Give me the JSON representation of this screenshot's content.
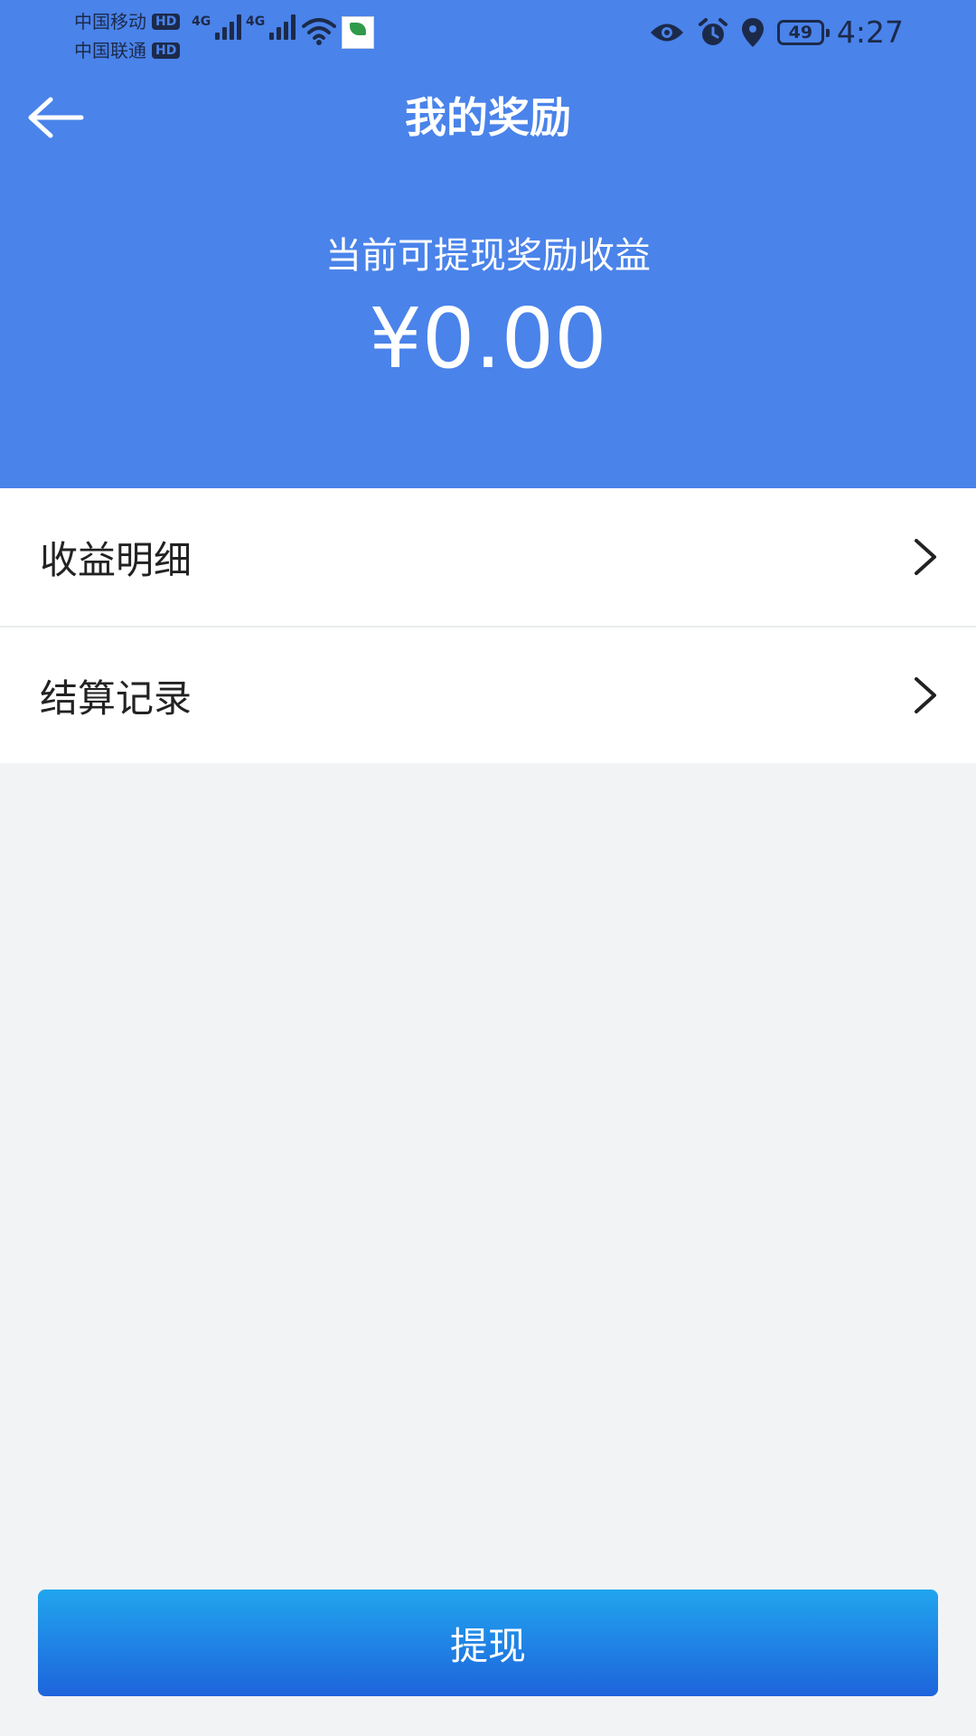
{
  "status_bar": {
    "carrier1": "中国移动",
    "carrier2": "中国联通",
    "hd": "HD",
    "net1": "4G",
    "net2": "4G",
    "battery": "49",
    "time": "4:27"
  },
  "header": {
    "title": "我的奖励",
    "subtitle": "当前可提现奖励收益",
    "amount": "¥0.00"
  },
  "list": {
    "items": [
      {
        "label": "收益明细"
      },
      {
        "label": "结算记录"
      }
    ]
  },
  "actions": {
    "withdraw_label": "提现"
  },
  "colors": {
    "header_bg": "#4a83ea",
    "page_bg": "#f2f3f5",
    "button_top": "#21a5ee",
    "button_bottom": "#1e64dc"
  }
}
